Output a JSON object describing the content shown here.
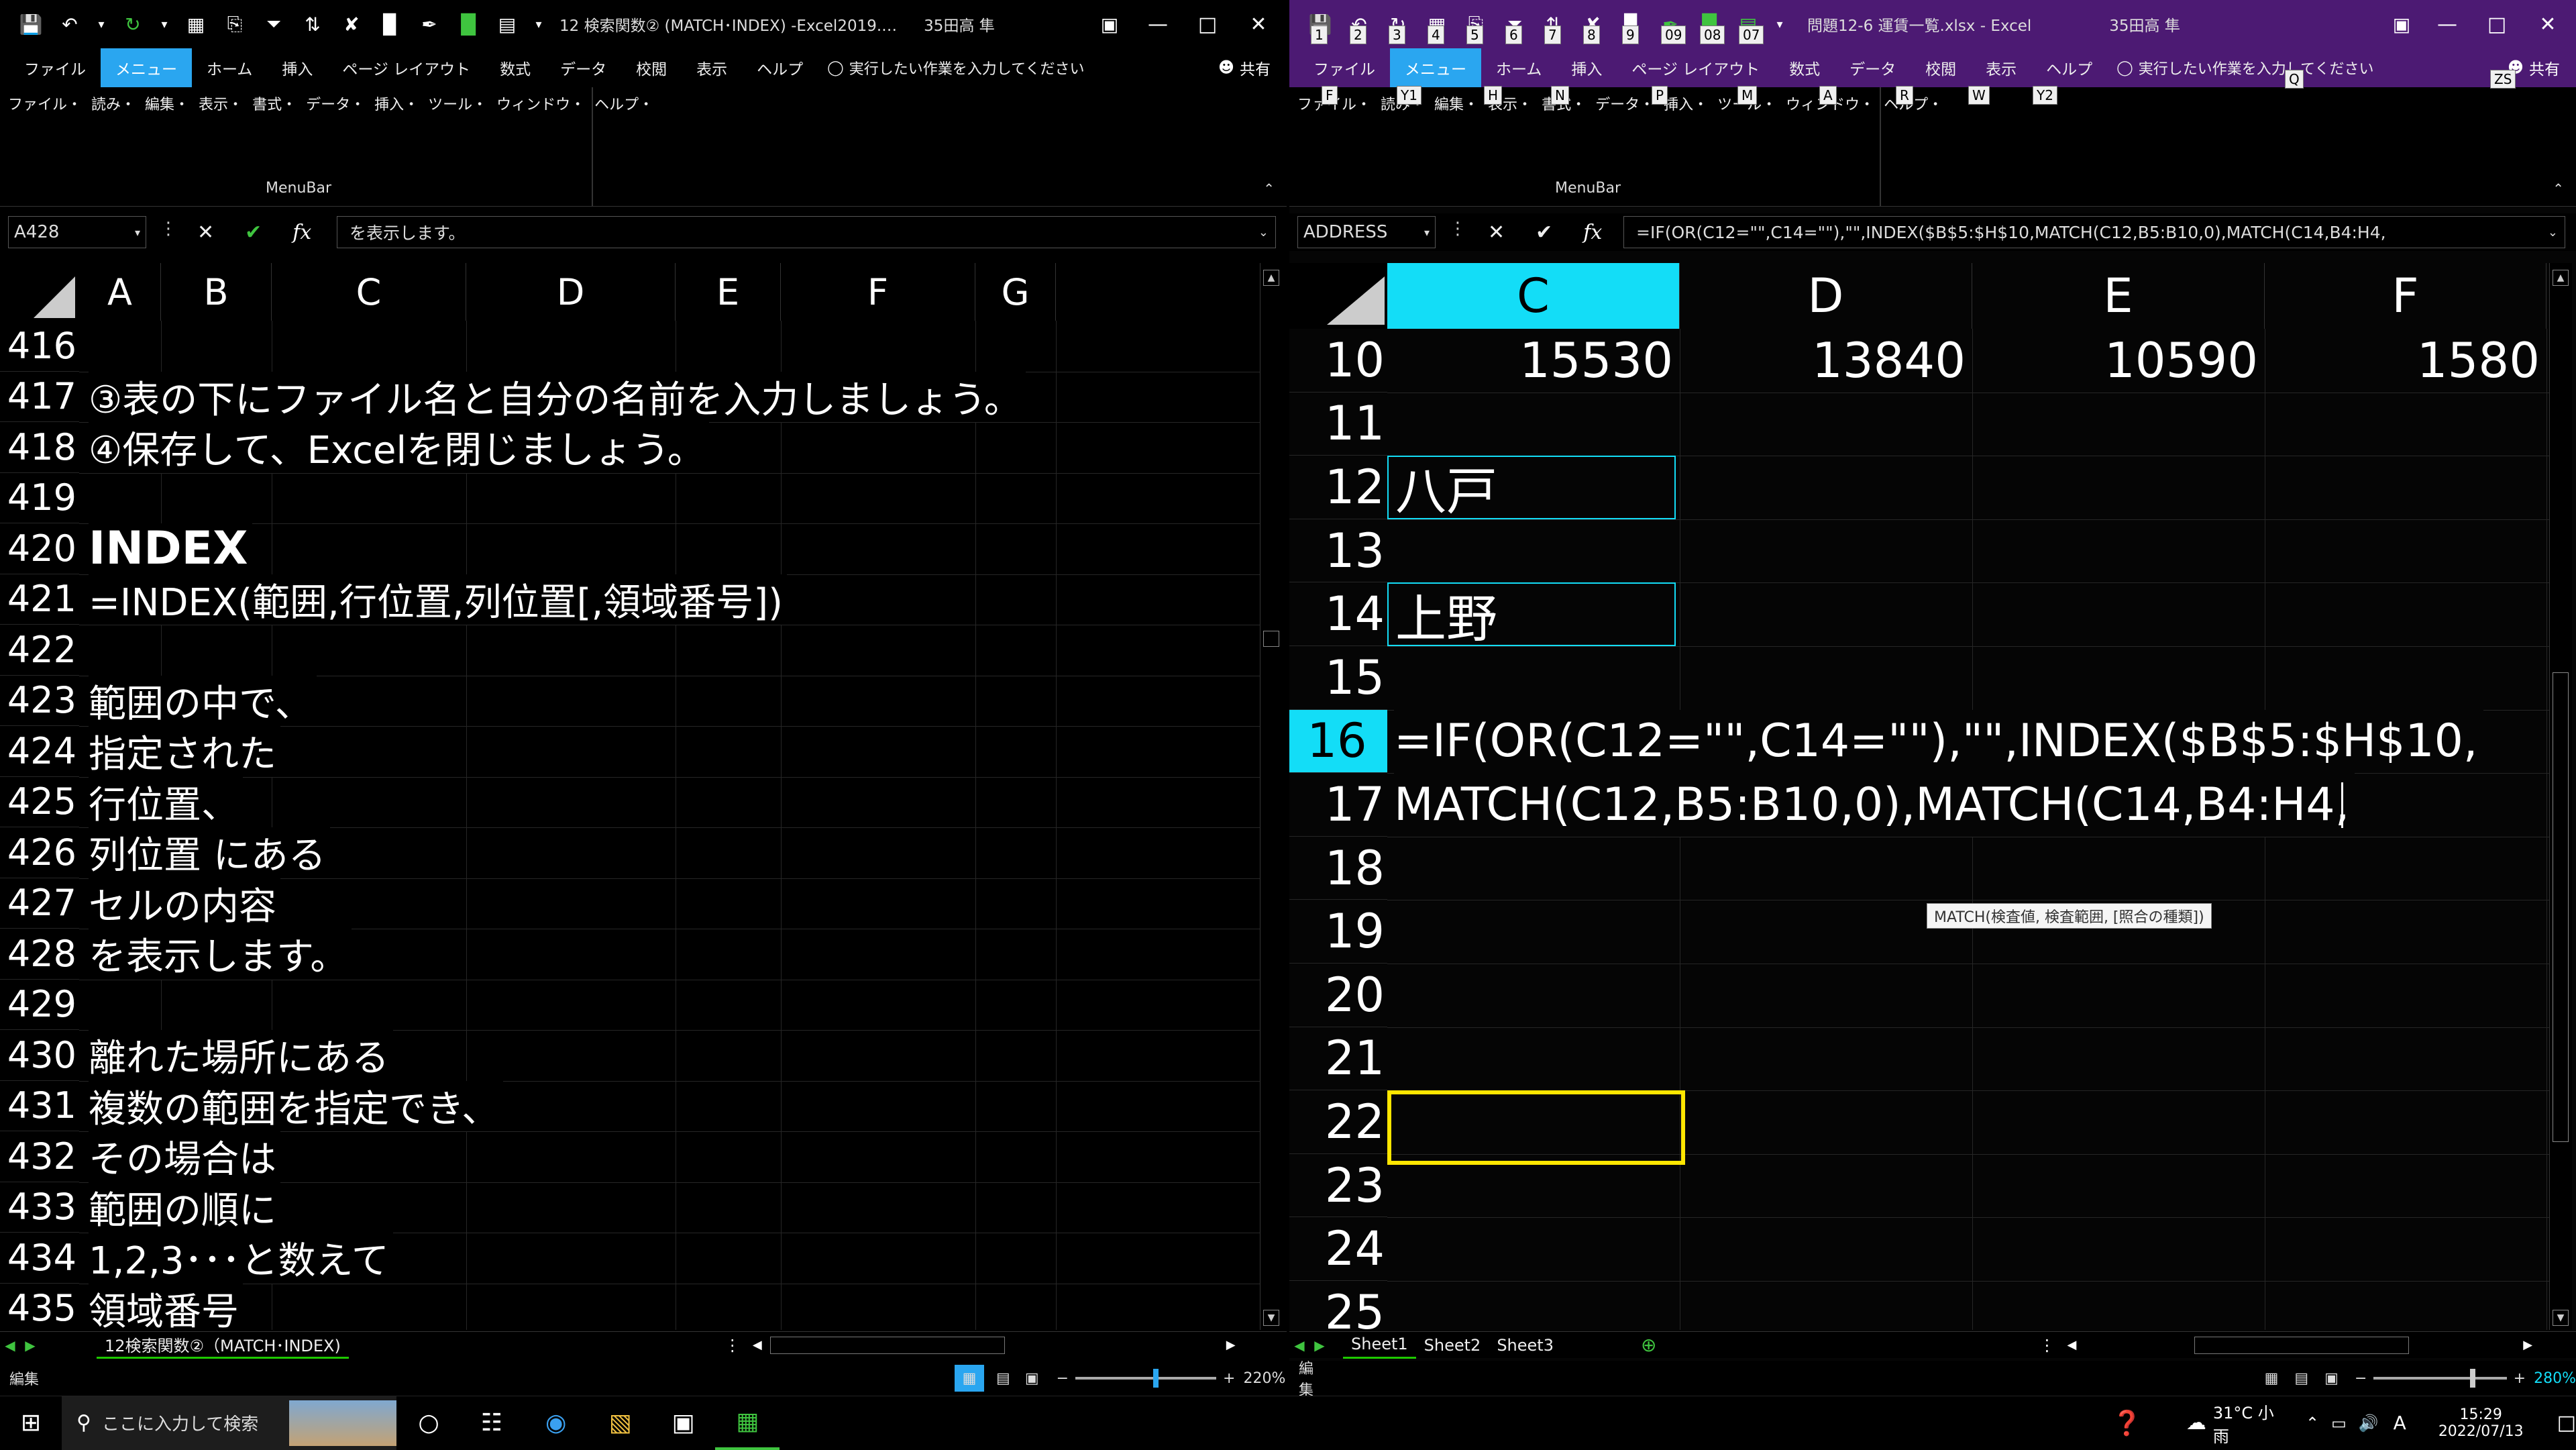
{
  "left_window": {
    "title": "12 検索関数② (MATCH･INDEX) -Excel2019.…",
    "user": "35田高 隼",
    "tabs": [
      "ファイル",
      "メニュー",
      "ホーム",
      "挿入",
      "ページ レイアウト",
      "数式",
      "データ",
      "校閲",
      "表示",
      "ヘルプ"
    ],
    "selected_tab": "メニュー",
    "tell_me": "実行したい作業を入力してください",
    "share": "共有",
    "menu_items": [
      "ファイル・",
      "読み・",
      "編集・",
      "表示・",
      "書式・",
      "データ・",
      "挿入・",
      "ツール・",
      "ウィンドウ・",
      "ヘルプ・"
    ],
    "menubar_label": "MenuBar",
    "name_box": "A428",
    "formula": "を表示します。",
    "columns": [
      "A",
      "B",
      "C",
      "D",
      "E",
      "F",
      "G"
    ],
    "rows": [
      {
        "n": "416",
        "text": ""
      },
      {
        "n": "417",
        "text": "③表の下にファイル名と自分の名前を入力しましょう。"
      },
      {
        "n": "418",
        "text": "④保存して、Excelを閉じましょう。"
      },
      {
        "n": "419",
        "text": ""
      },
      {
        "n": "420",
        "text": "INDEX"
      },
      {
        "n": "421",
        "text": "=INDEX(範囲,行位置,列位置[,領域番号])"
      },
      {
        "n": "422",
        "text": ""
      },
      {
        "n": "423",
        "text": "範囲の中で、"
      },
      {
        "n": "424",
        "text": "指定された"
      },
      {
        "n": "425",
        "text": "行位置、"
      },
      {
        "n": "426",
        "text": "列位置 にある"
      },
      {
        "n": "427",
        "text": "セルの内容"
      },
      {
        "n": "428",
        "text": "を表示します。"
      },
      {
        "n": "429",
        "text": ""
      },
      {
        "n": "430",
        "text": "離れた場所にある"
      },
      {
        "n": "431",
        "text": "複数の範囲を指定でき、"
      },
      {
        "n": "432",
        "text": "その場合は"
      },
      {
        "n": "433",
        "text": "範囲の順に"
      },
      {
        "n": "434",
        "text": "1,2,3･･･と数えて"
      },
      {
        "n": "435",
        "text": "領域番号"
      }
    ],
    "sheet_tab": "12検索関数②（MATCH･INDEX)",
    "status": "編集",
    "zoom": "220%",
    "zoom_fraction": 0.58
  },
  "right_window": {
    "title": "問題12-6 運賃一覧.xlsx  -  Excel",
    "user": "35田高 隼",
    "qat_keytips": [
      "1",
      "2",
      "3",
      "4",
      "5",
      "6",
      "7",
      "8",
      "9",
      "09",
      "08",
      "07"
    ],
    "tabs": [
      "ファイル",
      "メニュー",
      "ホーム",
      "挿入",
      "ページ レイアウト",
      "数式",
      "データ",
      "校閲",
      "表示",
      "ヘルプ"
    ],
    "selected_tab": "メニュー",
    "tell_me": "実行したい作業を入力してください",
    "share": "共有",
    "menu_items": [
      "ファイル・",
      "読み・",
      "編集・",
      "表示・",
      "書式・",
      "データ・",
      "挿入・",
      "ツール・",
      "ウィンドウ・",
      "ヘルプ・"
    ],
    "ribbon_keytips": [
      "F",
      "Y1",
      "H",
      "N",
      "P",
      "M",
      "A",
      "R",
      "W",
      "Y2",
      "Q",
      "ZS"
    ],
    "menubar_label": "MenuBar",
    "name_box": "ADDRESS",
    "formula": "=IF(OR(C12=\"\",C14=\"\"),\"\",INDEX($B$5:$H$10,MATCH(C12,B5:B10,0),MATCH(C14,B4:H4,",
    "columns": [
      "C",
      "D",
      "E",
      "F"
    ],
    "row10_values": [
      "15530",
      "13840",
      "10590",
      "1580"
    ],
    "rows": [
      {
        "n": "10",
        "text": ""
      },
      {
        "n": "11",
        "text": ""
      },
      {
        "n": "12",
        "text": "八戸"
      },
      {
        "n": "13",
        "text": ""
      },
      {
        "n": "14",
        "text": "上野"
      },
      {
        "n": "15",
        "text": ""
      },
      {
        "n": "16",
        "text": "=IF(OR(C12=\"\",C14=\"\"),\"\",INDEX($B$5:$H$10,"
      },
      {
        "n": "17",
        "text": "MATCH(C12,B5:B10,0),MATCH(C14,B4:H4,"
      },
      {
        "n": "18",
        "text": ""
      },
      {
        "n": "19",
        "text": ""
      },
      {
        "n": "20",
        "text": ""
      },
      {
        "n": "21",
        "text": ""
      },
      {
        "n": "22",
        "text": ""
      },
      {
        "n": "23",
        "text": ""
      },
      {
        "n": "24",
        "text": ""
      },
      {
        "n": "25",
        "text": ""
      }
    ],
    "tooltip": "MATCH(検査値, 検査範囲, [照合の種類])",
    "sheet_tabs": [
      "Sheet1",
      "Sheet2",
      "Sheet3"
    ],
    "status": "編集",
    "zoom": "280%",
    "zoom_fraction": 0.72
  },
  "taskbar": {
    "search_placeholder": "ここに入力して検索",
    "weather": "31°C  小雨",
    "ime": "A",
    "time": "15:29",
    "date": "2022/07/13"
  },
  "colors": {
    "selected_header": "#13ddf7",
    "active_cell": "#ffe600",
    "accent_tab": "#2aa6f0",
    "right_title": "#4c1a73"
  }
}
